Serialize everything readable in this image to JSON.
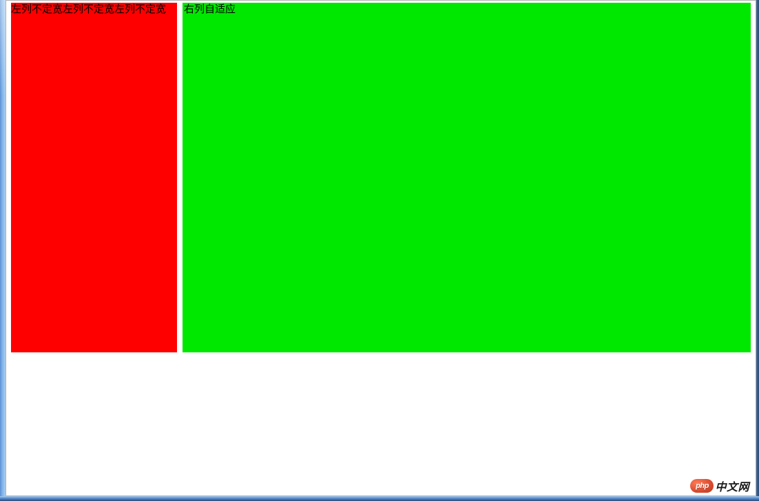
{
  "columns": {
    "left": {
      "text": "左列不定宽左列不定宽左列不定宽",
      "bg_color": "#ff0000"
    },
    "right": {
      "text": "右列自适应",
      "bg_color": "#00e800"
    }
  },
  "watermark": {
    "badge_text": "php",
    "label": "中文网"
  }
}
